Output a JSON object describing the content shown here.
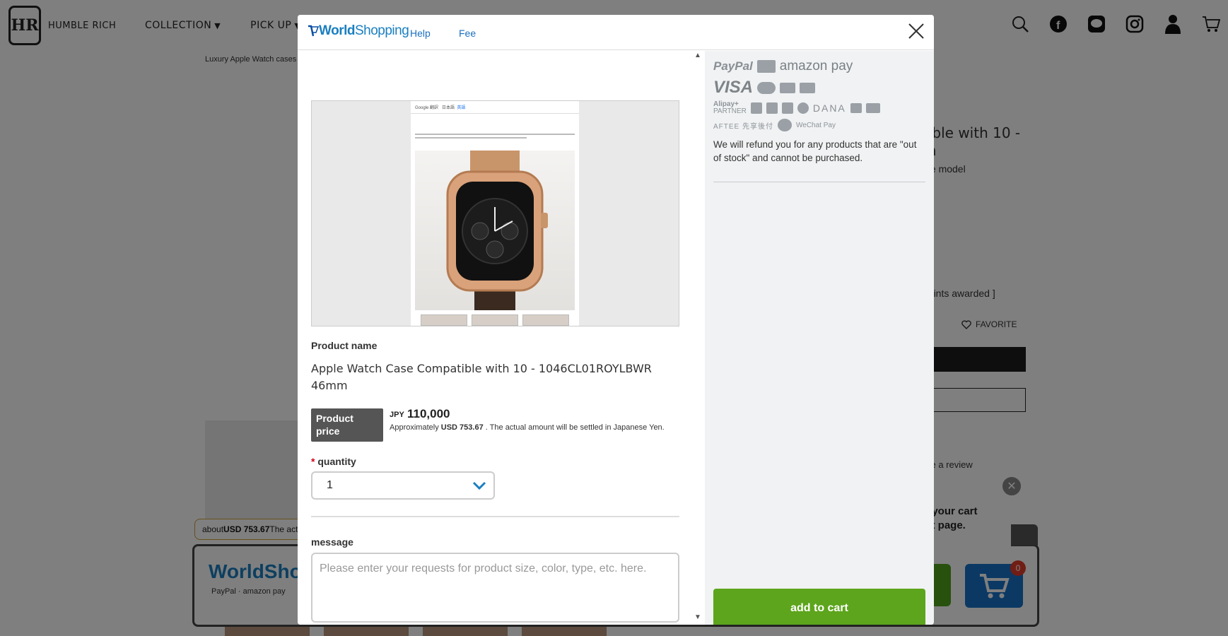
{
  "site": {
    "brand": "HUMBLE RICH",
    "logo_mark": "HR",
    "nav": [
      {
        "label": "COLLECTION"
      },
      {
        "label": "PICK UP"
      }
    ],
    "breadcrumb": "Luxury Apple Watch cases",
    "title_fragment_1": "tible with 10 -",
    "title_fragment_2": "m",
    "subtitle_fragment": "ble model",
    "points_fragment": "points awarded ]",
    "favorite_label": "FAVORITE",
    "outline_btn_fragment": "u",
    "review_fragment": "ite a review"
  },
  "widget": {
    "tip_prefix": "about",
    "tip_price": "USD 753.67",
    "tip_suffix": "The act",
    "logo": "WorldShop",
    "popup_line_1": "to your cart",
    "popup_line_2": "uct page.",
    "close_fragment": "se",
    "cart_fragment": "rt",
    "cart_count": "0"
  },
  "modal": {
    "logo_world": "World",
    "logo_shopping": "Shopping",
    "links": [
      "Help",
      "Fee"
    ],
    "screenshot": {
      "bar_left": "Google 翻訳",
      "bar_mid": "日本語",
      "bar_right": "英語"
    },
    "product_name_label": "Product name",
    "product_name": "Apple Watch Case Compatible with 10 - 1046CL01ROYLBWR 46mm",
    "price_label": "Product price",
    "currency": "JPY",
    "price": "110,000",
    "approx_prefix": "Approximately",
    "approx_usd": "USD 753.67",
    "approx_suffix": ". The actual amount will be settled in Japanese Yen.",
    "quantity_label": "quantity",
    "quantity_value": "1",
    "message_label": "message",
    "message_placeholder": "Please enter your requests for product size, color, type, etc. here.",
    "payments": {
      "paypal": "PayPal",
      "amazon_pay": "amazon pay",
      "visa": "VISA",
      "alipay": "Alipay+",
      "alipay_sub": "PARTNER",
      "dana": "DANA",
      "aftee": "AFTEE 先享後付",
      "wechat": "WeChat Pay"
    },
    "refund_note": "We will refund you for any products that are \"out of stock\" and cannot be purchased.",
    "add_to_cart_label": "add to cart"
  },
  "colors": {
    "accent_blue": "#1a7fc0",
    "add_to_cart_green": "#5da51c",
    "price_badge": "#555555",
    "required_star": "#d0021b"
  }
}
